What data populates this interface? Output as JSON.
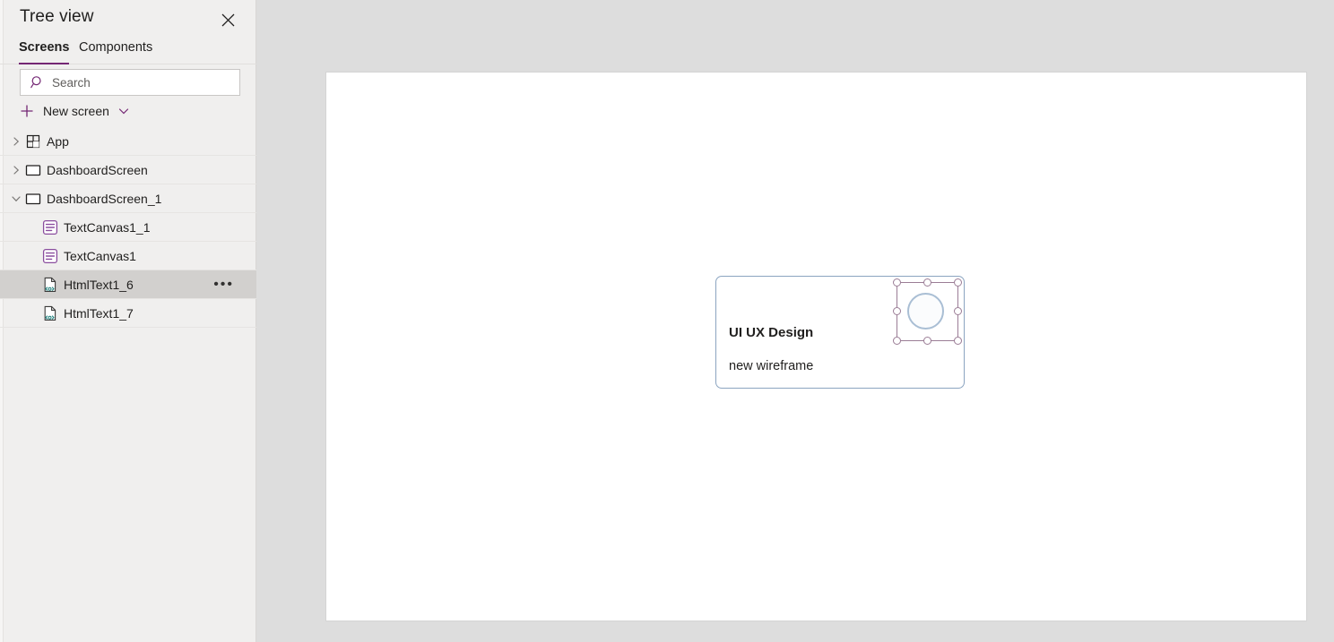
{
  "panel": {
    "title": "Tree view",
    "close_icon": "close-icon",
    "tabs": [
      {
        "label": "Screens",
        "selected": true
      },
      {
        "label": "Components",
        "selected": false
      }
    ],
    "search": {
      "placeholder": "Search",
      "value": "",
      "icon": "search-icon"
    },
    "new_screen": {
      "label": "New screen",
      "plus_icon": "plus-icon",
      "chevron_icon": "chevron-down-icon"
    },
    "more_menu_label": "•••"
  },
  "tree": {
    "items": [
      {
        "label": "App",
        "icon": "app-grid-icon",
        "depth": 0,
        "expanded": false,
        "chevron": "chevron-right-icon",
        "selected": false,
        "has_more": false
      },
      {
        "label": "DashboardScreen",
        "icon": "screen-icon",
        "depth": 0,
        "expanded": false,
        "chevron": "chevron-right-icon",
        "selected": false,
        "has_more": false
      },
      {
        "label": "DashboardScreen_1",
        "icon": "screen-icon",
        "depth": 0,
        "expanded": true,
        "chevron": "chevron-down-icon",
        "selected": false,
        "has_more": false
      },
      {
        "label": "TextCanvas1_1",
        "icon": "text-canvas-icon",
        "depth": 1,
        "expanded": null,
        "chevron": null,
        "selected": false,
        "has_more": false
      },
      {
        "label": "TextCanvas1",
        "icon": "text-canvas-icon",
        "depth": 1,
        "expanded": null,
        "chevron": null,
        "selected": false,
        "has_more": false
      },
      {
        "label": "HtmlText1_6",
        "icon": "html-text-icon",
        "depth": 1,
        "expanded": null,
        "chevron": null,
        "selected": true,
        "has_more": true
      },
      {
        "label": "HtmlText1_7",
        "icon": "html-text-icon",
        "depth": 1,
        "expanded": null,
        "chevron": null,
        "selected": false,
        "has_more": false
      }
    ]
  },
  "canvas": {
    "card": {
      "title": "UI UX Design",
      "subtitle": "new wireframe",
      "border_color": "#8ba4c0"
    },
    "selection": {
      "handle_count": 8,
      "border_color": "#9b7d96",
      "selected_element": "HtmlText1_6"
    },
    "circle": {
      "fill_color": "#fbfcfd",
      "border_color": "#a9bed4"
    }
  },
  "colors": {
    "accent": "#742774",
    "panel_background": "#f0efee",
    "workspace_background": "#dddddd",
    "canvas_background": "#ffffff",
    "row_selected": "#d2d0ce",
    "text_primary": "#201f1e"
  }
}
